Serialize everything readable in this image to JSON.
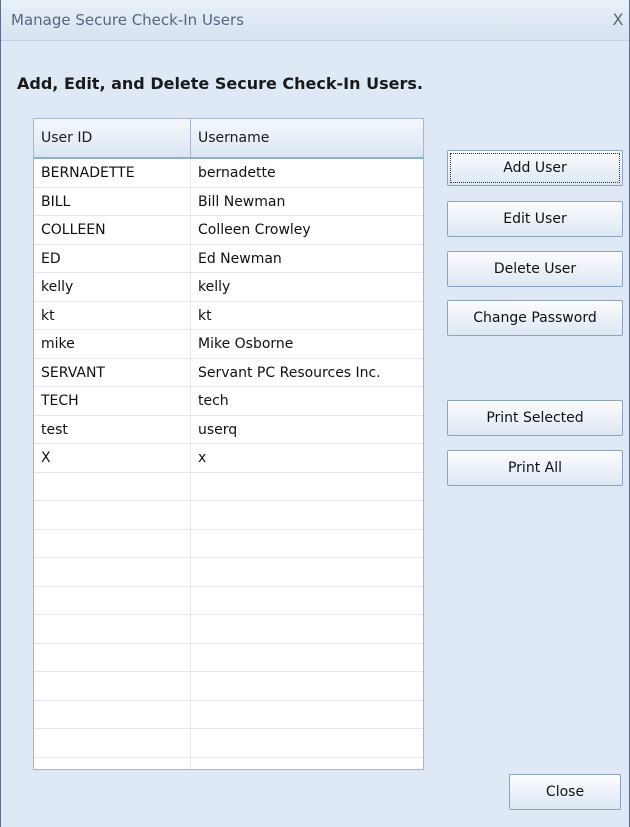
{
  "window": {
    "title": "Manage Secure Check-In Users",
    "close_glyph": "X"
  },
  "heading": "Add, Edit, and Delete Secure Check-In Users.",
  "table": {
    "columns": [
      "User ID",
      "Username"
    ],
    "rows": [
      [
        "BERNADETTE",
        "bernadette"
      ],
      [
        "BILL",
        "Bill Newman"
      ],
      [
        "COLLEEN",
        "Colleen Crowley"
      ],
      [
        "ED",
        "Ed Newman"
      ],
      [
        "kelly",
        "kelly"
      ],
      [
        "kt",
        "kt"
      ],
      [
        "mike",
        "Mike Osborne"
      ],
      [
        "SERVANT",
        "Servant PC Resources Inc."
      ],
      [
        "TECH",
        "tech"
      ],
      [
        "test",
        "userq"
      ],
      [
        "X",
        "x"
      ],
      [
        "",
        ""
      ],
      [
        "",
        ""
      ],
      [
        "",
        ""
      ],
      [
        "",
        ""
      ],
      [
        "",
        ""
      ],
      [
        "",
        ""
      ],
      [
        "",
        ""
      ],
      [
        "",
        ""
      ],
      [
        "",
        ""
      ],
      [
        "",
        ""
      ],
      [
        "",
        ""
      ]
    ]
  },
  "buttons": {
    "add_user": "Add User",
    "edit_user": "Edit User",
    "delete_user": "Delete User",
    "change_password": "Change Password",
    "print_selected": "Print Selected",
    "print_all": "Print All",
    "close": "Close"
  },
  "colors": {
    "window_bg": "#dfe9f5",
    "header_accent": "#8fb0d6"
  }
}
